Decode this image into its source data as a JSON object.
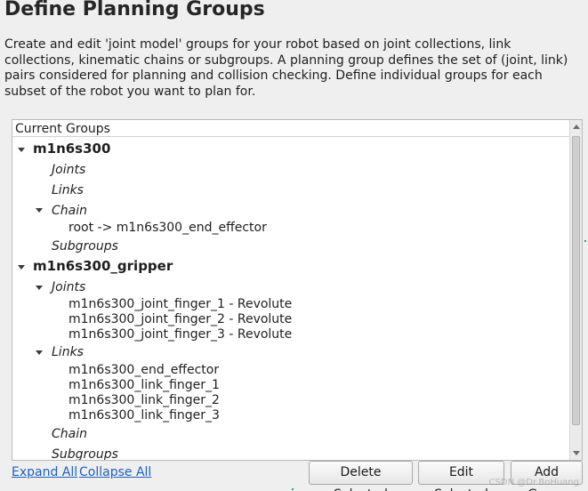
{
  "header": {
    "title": "Define Planning Groups",
    "description": "Create and edit 'joint model' groups for your robot based on joint collections, link collections, kinematic chains or subgroups. A planning group defines the set of (joint, link) pairs considered for planning and collision checking. Define individual groups for each subset of the robot you want to plan for."
  },
  "tree": {
    "column_header": "Current Groups",
    "groups": [
      {
        "name": "m1n6s300",
        "joints_label": "Joints",
        "links_label": "Links",
        "chain_label": "Chain",
        "chain_value": "root  ->  m1n6s300_end_effector",
        "subgroups_label": "Subgroups"
      },
      {
        "name": "m1n6s300_gripper",
        "joints_label": "Joints",
        "joints": [
          "m1n6s300_joint_finger_1 - Revolute",
          "m1n6s300_joint_finger_2 - Revolute",
          "m1n6s300_joint_finger_3 - Revolute"
        ],
        "links_label": "Links",
        "links": [
          "m1n6s300_end_effector",
          "m1n6s300_link_finger_1",
          "m1n6s300_link_finger_2",
          "m1n6s300_link_finger_3"
        ],
        "chain_label": "Chain",
        "subgroups_label": "Subgroups"
      }
    ]
  },
  "footer": {
    "expand_all": "Expand All",
    "collapse_all": "Collapse All",
    "delete_selected": "Delete Selected",
    "edit_selected": "Edit Selected",
    "add_group": "Add Group"
  },
  "watermark": "CSDN @Dr.BoHuang"
}
